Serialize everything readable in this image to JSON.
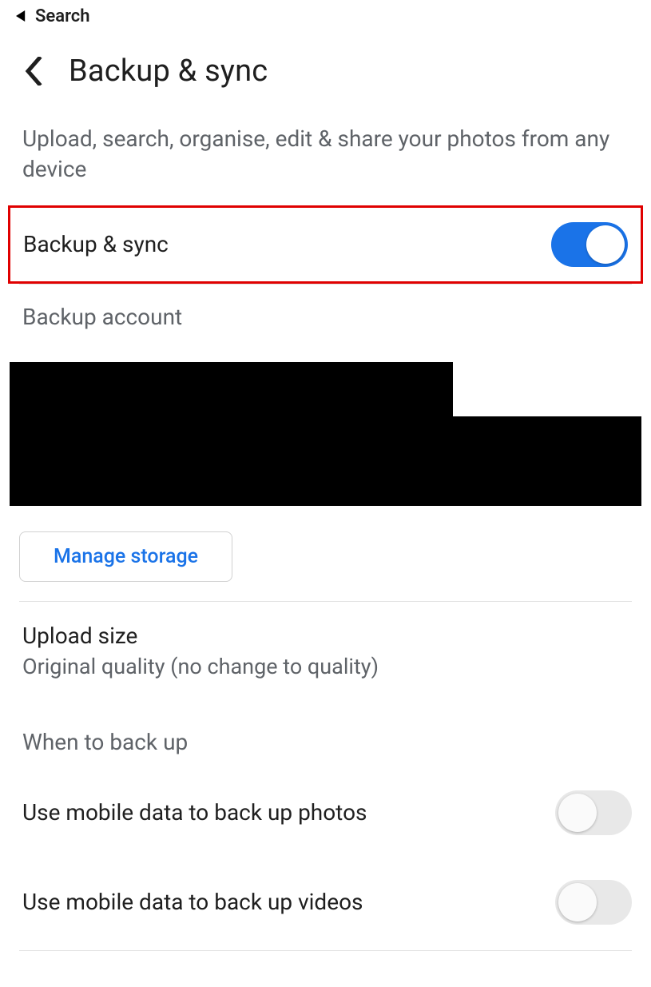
{
  "statusBar": {
    "backLabel": "Search"
  },
  "header": {
    "title": "Backup & sync"
  },
  "description": "Upload, search, organise, edit & share your photos from any device",
  "backupSync": {
    "label": "Backup & sync",
    "enabled": true
  },
  "backupAccount": {
    "heading": "Backup account"
  },
  "manageStorage": {
    "label": "Manage storage"
  },
  "uploadSize": {
    "title": "Upload size",
    "subtitle": "Original quality (no change to quality)"
  },
  "whenToBackUp": {
    "heading": "When to back up",
    "options": [
      {
        "label": "Use mobile data to back up photos",
        "enabled": false
      },
      {
        "label": "Use mobile data to back up videos",
        "enabled": false
      }
    ]
  }
}
